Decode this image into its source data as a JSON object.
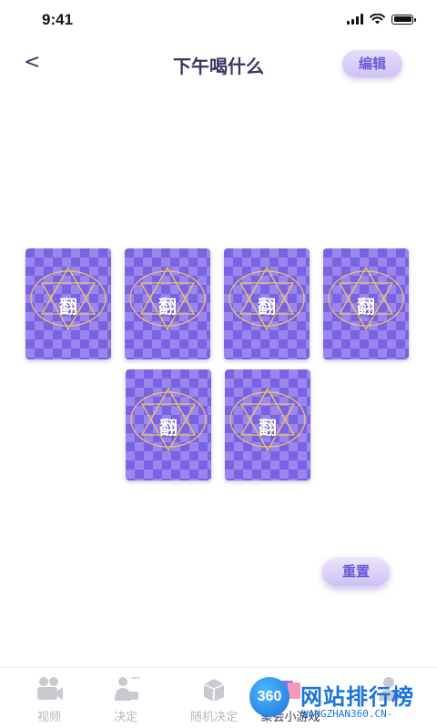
{
  "status_bar": {
    "time": "9:41"
  },
  "header": {
    "back": "<",
    "title": "下午喝什么",
    "edit_label": "编辑"
  },
  "cards": [
    {
      "label": "翻"
    },
    {
      "label": "翻"
    },
    {
      "label": "翻"
    },
    {
      "label": "翻"
    },
    {
      "label": "翻"
    },
    {
      "label": "翻"
    }
  ],
  "reset_label": "重置",
  "tabs": [
    {
      "label": "视频",
      "icon": "video-camera-icon"
    },
    {
      "label": "决定",
      "icon": "decide-icon"
    },
    {
      "label": "随机决定",
      "icon": "random-box-icon"
    },
    {
      "label": "聚会小游戏",
      "icon": "party-game-icon"
    },
    {
      "label": "",
      "icon": "profile-icon"
    }
  ],
  "watermark": {
    "badge": "360",
    "brand": "网站排行榜",
    "url": "WANGZHAN360.CN-"
  },
  "colors": {
    "card_base": "#7a63e0",
    "card_pattern": "#9a86ee",
    "card_lines": "#e8c86a",
    "accent": "#6c5bd4",
    "title": "#3a3560"
  }
}
